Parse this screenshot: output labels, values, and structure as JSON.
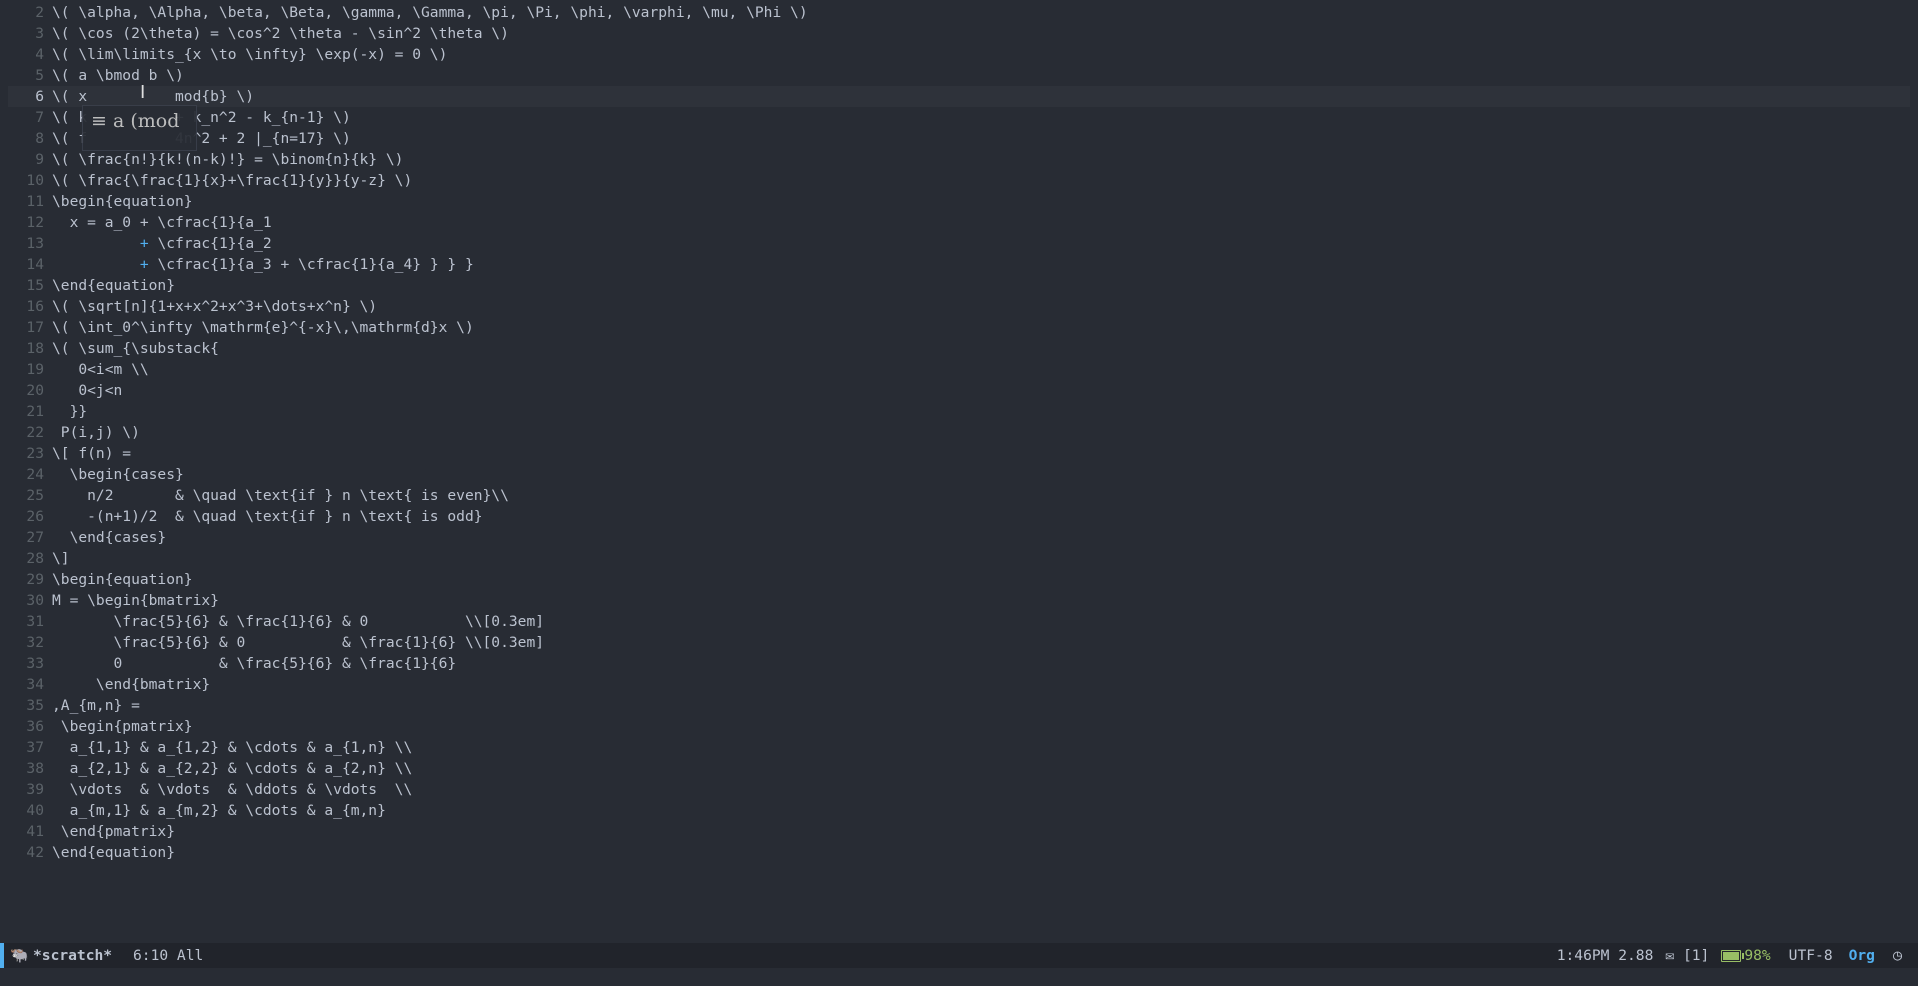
{
  "editor": {
    "lines": [
      {
        "n": "2",
        "text": "\\( \\alpha, \\Alpha, \\beta, \\Beta, \\gamma, \\Gamma, \\pi, \\Pi, \\phi, \\varphi, \\mu, \\Phi \\)"
      },
      {
        "n": "3",
        "text": "\\( \\cos (2\\theta) = \\cos^2 \\theta - \\sin^2 \\theta \\)"
      },
      {
        "n": "4",
        "text": "\\( \\lim\\limits_{x \\to \\infty} \\exp(-x) = 0 \\)"
      },
      {
        "n": "5",
        "text": "\\( a \\bmod b \\)"
      },
      {
        "n": "6",
        "text": "\\( x          mod{b} \\)"
      },
      {
        "n": "7",
        "text": "\\( k          + k_n^2 - k_{n-1} \\)"
      },
      {
        "n": "8",
        "text": "\\( f          4n^2 + 2 |_{n=17} \\)"
      },
      {
        "n": "9",
        "text": "\\( \\frac{n!}{k!(n-k)!} = \\binom{n}{k} \\)"
      },
      {
        "n": "10",
        "text": "\\( \\frac{\\frac{1}{x}+\\frac{1}{y}}{y-z} \\)"
      },
      {
        "n": "11",
        "text": "\\begin{equation}"
      },
      {
        "n": "12",
        "text": "  x = a_0 + \\cfrac{1}{a_1"
      },
      {
        "n": "13",
        "text": "          + \\cfrac{1}{a_2"
      },
      {
        "n": "14",
        "text": "          + \\cfrac{1}{a_3 + \\cfrac{1}{a_4} } } }"
      },
      {
        "n": "15",
        "text": "\\end{equation}"
      },
      {
        "n": "16",
        "text": "\\( \\sqrt[n]{1+x+x^2+x^3+\\dots+x^n} \\)"
      },
      {
        "n": "17",
        "text": "\\( \\int_0^\\infty \\mathrm{e}^{-x}\\,\\mathrm{d}x \\)"
      },
      {
        "n": "18",
        "text": "\\( \\sum_{\\substack{"
      },
      {
        "n": "19",
        "text": "   0<i<m \\\\"
      },
      {
        "n": "20",
        "text": "   0<j<n"
      },
      {
        "n": "21",
        "text": "  }}"
      },
      {
        "n": "22",
        "text": " P(i,j) \\)"
      },
      {
        "n": "23",
        "text": "\\[ f(n) ="
      },
      {
        "n": "24",
        "text": "  \\begin{cases}"
      },
      {
        "n": "25",
        "text": "    n/2       & \\quad \\text{if } n \\text{ is even}\\\\"
      },
      {
        "n": "26",
        "text": "    -(n+1)/2  & \\quad \\text{if } n \\text{ is odd}"
      },
      {
        "n": "27",
        "text": "  \\end{cases}"
      },
      {
        "n": "28",
        "text": "\\]"
      },
      {
        "n": "29",
        "text": "\\begin{equation}"
      },
      {
        "n": "30",
        "text": "M = \\begin{bmatrix}"
      },
      {
        "n": "31",
        "text": "       \\frac{5}{6} & \\frac{1}{6} & 0           \\\\[0.3em]"
      },
      {
        "n": "32",
        "text": "       \\frac{5}{6} & 0           & \\frac{1}{6} \\\\[0.3em]"
      },
      {
        "n": "33",
        "text": "       0           & \\frac{5}{6} & \\frac{1}{6}"
      },
      {
        "n": "34",
        "text": "     \\end{bmatrix}"
      },
      {
        "n": "35",
        "text": ",A_{m,n} ="
      },
      {
        "n": "36",
        "text": " \\begin{pmatrix}"
      },
      {
        "n": "37",
        "text": "  a_{1,1} & a_{1,2} & \\cdots & a_{1,n} \\\\"
      },
      {
        "n": "38",
        "text": "  a_{2,1} & a_{2,2} & \\cdots & a_{2,n} \\\\"
      },
      {
        "n": "39",
        "text": "  \\vdots  & \\vdots  & \\ddots & \\vdots  \\\\"
      },
      {
        "n": "40",
        "text": "  a_{m,1} & a_{m,2} & \\cdots & a_{m,n}"
      },
      {
        "n": "41",
        "text": " \\end{pmatrix}"
      },
      {
        "n": "42",
        "text": "\\end{equation}"
      }
    ],
    "current_line": "6",
    "preview_overlay": "≡ a (mod",
    "mouse_cursor_icon": "i-beam-cursor-icon"
  },
  "modeline": {
    "mode_icon": "emacs-gnu-icon",
    "buffer_name": "*scratch*",
    "position": "6:10 All",
    "time_load": "1:46PM 2.88",
    "mail": "✉ [1]",
    "battery": "98%",
    "battery_level": 0.98,
    "encoding": "UTF-8",
    "major_mode": "Org",
    "clock_icon": "clock-icon",
    "accent_color": "#51afef",
    "battery_color": "#98be65"
  }
}
